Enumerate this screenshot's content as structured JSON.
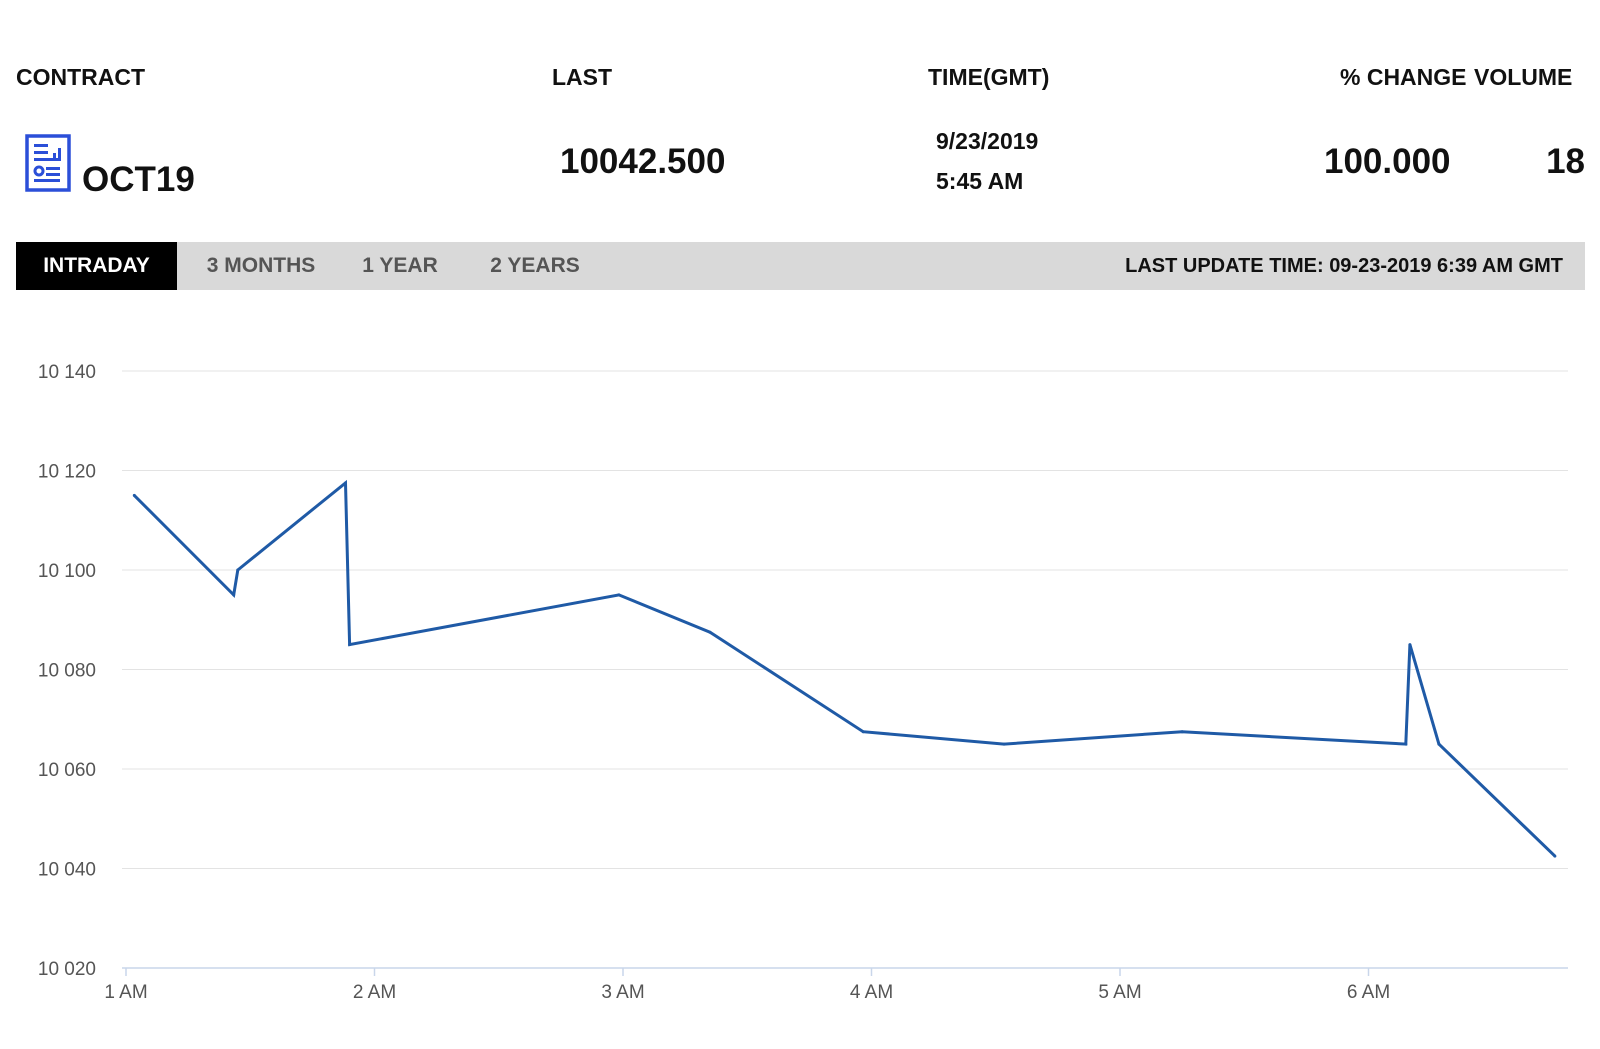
{
  "header": {
    "contract_label": "CONTRACT",
    "last_label": "LAST",
    "time_label": "TIME(GMT)",
    "change_label": "% CHANGE",
    "volume_label": "VOLUME"
  },
  "quote": {
    "contract": "OCT19",
    "contract_icon": "report-document-icon",
    "last": "10042.500",
    "date": "9/23/2019",
    "time": "5:45 AM",
    "change": "100.000",
    "volume": "18"
  },
  "tabs": {
    "intraday": "INTRADAY",
    "three_months": "3 MONTHS",
    "one_year": "1 YEAR",
    "two_years": "2 YEARS",
    "active": "INTRADAY"
  },
  "last_update": "LAST UPDATE TIME: 09-23-2019 6:39 AM GMT",
  "colors": {
    "line": "#1f5aa6",
    "grid": "#e3e3e3",
    "axis": "#c9d6ea",
    "icon": "#2b4fd8",
    "active_tab_bg": "#000000",
    "tabbar_bg": "#d9d9d9"
  },
  "chart_data": {
    "type": "line",
    "title": "",
    "xlabel": "",
    "ylabel": "",
    "x_ticks": [
      "1 AM",
      "2 AM",
      "3 AM",
      "4 AM",
      "5 AM",
      "6 AM"
    ],
    "y_ticks": [
      "10 020",
      "10 040",
      "10 060",
      "10 080",
      "10 100",
      "10 120",
      "10 140"
    ],
    "ylim": [
      10020,
      10140
    ],
    "xlim": [
      "1:00 AM",
      "6:50 AM"
    ],
    "grid": true,
    "series": [
      {
        "points": [
          {
            "x": "1:02 AM",
            "y": 10115
          },
          {
            "x": "1:26 AM",
            "y": 10095
          },
          {
            "x": "1:27 AM",
            "y": 10100
          },
          {
            "x": "1:53 AM",
            "y": 10117.5
          },
          {
            "x": "1:54 AM",
            "y": 10085
          },
          {
            "x": "2:59 AM",
            "y": 10095
          },
          {
            "x": "3:21 AM",
            "y": 10087.5
          },
          {
            "x": "3:58 AM",
            "y": 10067.5
          },
          {
            "x": "4:32 AM",
            "y": 10065
          },
          {
            "x": "5:15 AM",
            "y": 10067.5
          },
          {
            "x": "6:09 AM",
            "y": 10065
          },
          {
            "x": "6:10 AM",
            "y": 10085
          },
          {
            "x": "6:17 AM",
            "y": 10065
          },
          {
            "x": "6:45 AM",
            "y": 10042.5
          }
        ]
      }
    ]
  }
}
